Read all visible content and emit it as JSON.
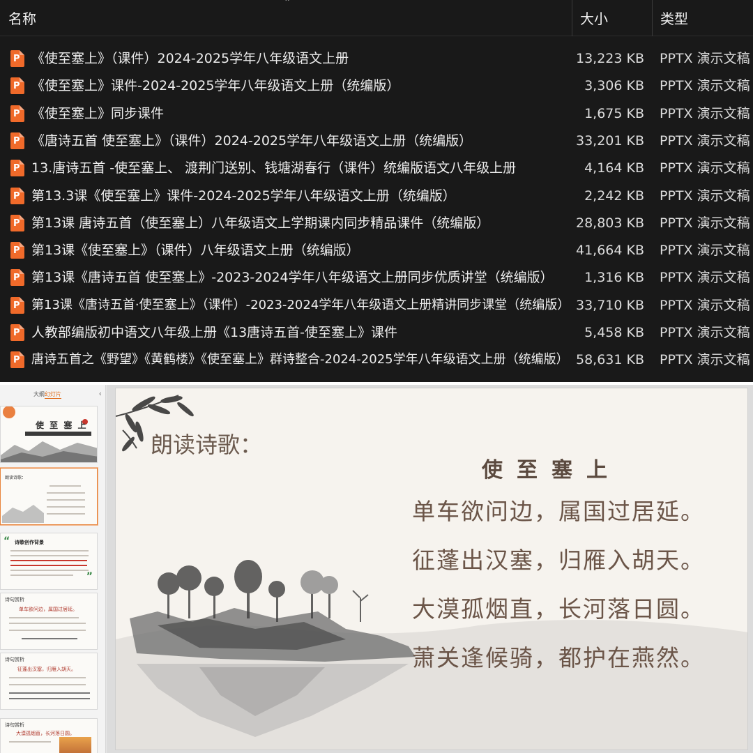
{
  "explorer": {
    "columns": {
      "name": "名称",
      "size": "大小",
      "type": "类型"
    },
    "files": [
      {
        "name": "《使至塞上》（课件）2024-2025学年八年级语文上册",
        "size": "13,223 KB",
        "type": "PPTX 演示文稿"
      },
      {
        "name": "《使至塞上》课件-2024-2025学年八年级语文上册（统编版）",
        "size": "3,306 KB",
        "type": "PPTX 演示文稿"
      },
      {
        "name": "《使至塞上》同步课件",
        "size": "1,675 KB",
        "type": "PPTX 演示文稿"
      },
      {
        "name": "《唐诗五首 使至塞上》（课件）2024-2025学年八年级语文上册（统编版）",
        "size": "33,201 KB",
        "type": "PPTX 演示文稿"
      },
      {
        "name": "13.唐诗五首 -使至塞上、 渡荆门送别、钱塘湖春行（课件）统编版语文八年级上册",
        "size": "4,164 KB",
        "type": "PPTX 演示文稿"
      },
      {
        "name": "第13.3课《使至塞上》课件-2024-2025学年八年级语文上册（统编版）",
        "size": "2,242 KB",
        "type": "PPTX 演示文稿"
      },
      {
        "name": "第13课 唐诗五首（使至塞上）八年级语文上学期课内同步精品课件（统编版）",
        "size": "28,803 KB",
        "type": "PPTX 演示文稿"
      },
      {
        "name": "第13课《使至塞上》（课件）八年级语文上册（统编版）",
        "size": "41,664 KB",
        "type": "PPTX 演示文稿"
      },
      {
        "name": "第13课《唐诗五首 使至塞上》-2023-2024学年八年级语文上册同步优质讲堂（统编版）",
        "size": "1,316 KB",
        "type": "PPTX 演示文稿"
      },
      {
        "name": "第13课《唐诗五首·使至塞上》（课件）-2023-2024学年八年级语文上册精讲同步课堂（统编版）",
        "size": "33,710 KB",
        "type": "PPTX 演示文稿"
      },
      {
        "name": "人教部编版初中语文八年级上册《13唐诗五首-使至塞上》课件",
        "size": "5,458 KB",
        "type": "PPTX 演示文稿"
      },
      {
        "name": "唐诗五首之《野望》《黄鹤楼》《使至塞上》群诗整合-2024-2025学年八年级语文上册（统编版）",
        "size": "58,631 KB",
        "type": "PPTX 演示文稿"
      }
    ]
  },
  "editor": {
    "tabs": {
      "outline": "大纲",
      "slides": "幻灯片"
    },
    "thumbnails": {
      "t1_title": "使 至 塞 上",
      "t2_title": "朗读诗歌：",
      "t3_title": "诗歌创作背景",
      "t4_title": "诗句赏析",
      "t4_line": "单车欲问边，属国过居延。",
      "t5_title": "诗句赏析",
      "t5_line": "征蓬出汉塞，归雁入胡天。",
      "t6_title": "诗句赏析",
      "t6_line": "大漠孤烟直，长河落日圆。"
    },
    "slide": {
      "label": "朗读诗歌：",
      "poem_title": "使至塞上",
      "lines": [
        "单车欲问边，属国过居延。",
        "征蓬出汉塞，归雁入胡天。",
        "大漠孤烟直，长河落日圆。",
        "萧关逢候骑，都护在燕然。"
      ]
    }
  }
}
